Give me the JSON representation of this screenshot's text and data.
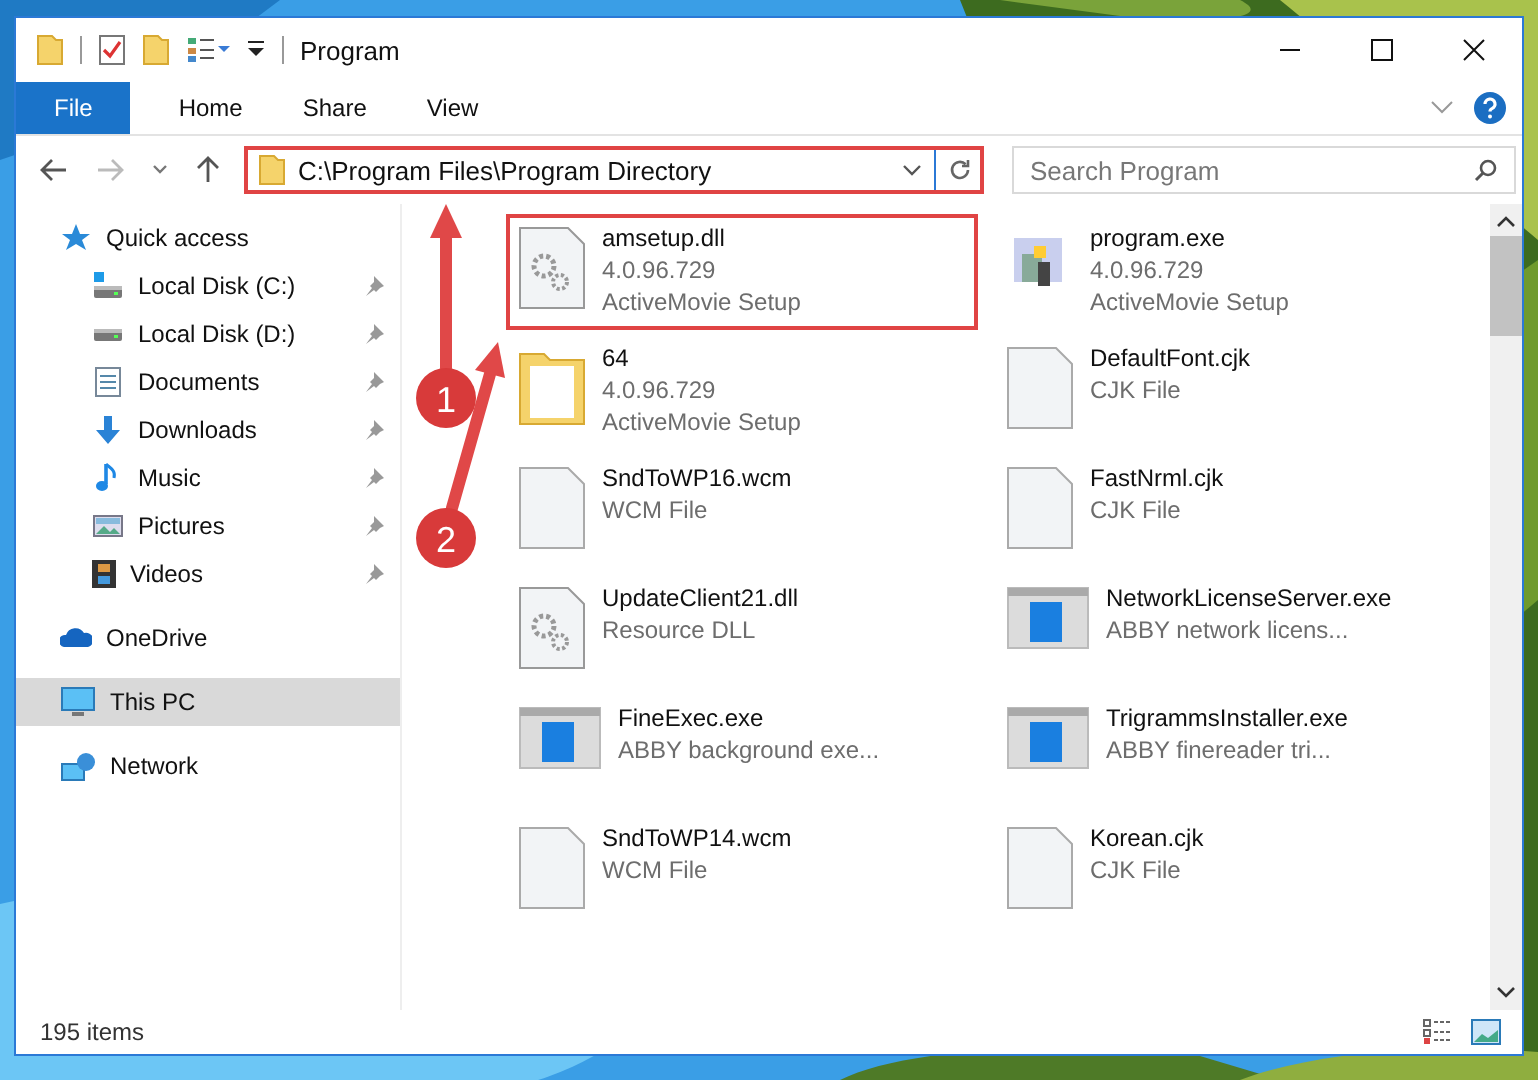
{
  "window": {
    "title": "Program"
  },
  "ribbon_tabs": [
    {
      "label": "File",
      "selected": true
    },
    {
      "label": "Home",
      "selected": false
    },
    {
      "label": "Share",
      "selected": false
    },
    {
      "label": "View",
      "selected": false
    }
  ],
  "address": {
    "path": "C:\\Program Files\\Program Directory",
    "highlighted": true
  },
  "search": {
    "placeholder": "Search Program"
  },
  "sidebar": {
    "items": [
      {
        "label": "Quick access",
        "kind": "quick",
        "pinned": false,
        "selected": false
      },
      {
        "label": "Local Disk (C:)",
        "kind": "drive-c",
        "pinned": true,
        "selected": false
      },
      {
        "label": "Local Disk (D:)",
        "kind": "drive",
        "pinned": true,
        "selected": false
      },
      {
        "label": "Documents",
        "kind": "documents",
        "pinned": true,
        "selected": false
      },
      {
        "label": "Downloads",
        "kind": "downloads",
        "pinned": true,
        "selected": false
      },
      {
        "label": "Music",
        "kind": "music",
        "pinned": true,
        "selected": false
      },
      {
        "label": "Pictures",
        "kind": "pictures",
        "pinned": true,
        "selected": false
      },
      {
        "label": "Videos",
        "kind": "videos",
        "pinned": true,
        "selected": false
      },
      {
        "label": "OneDrive",
        "kind": "cloud",
        "pinned": false,
        "selected": false
      },
      {
        "label": "This PC",
        "kind": "pc",
        "pinned": false,
        "selected": true
      },
      {
        "label": "Network",
        "kind": "network",
        "pinned": false,
        "selected": false
      }
    ]
  },
  "files": [
    {
      "name": "amsetup.dll",
      "lines": [
        "4.0.96.729",
        "ActiveMovie Setup"
      ],
      "kind": "dll",
      "highlighted": true
    },
    {
      "name": "program.exe",
      "lines": [
        "4.0.96.729",
        "ActiveMovie Setup"
      ],
      "kind": "setup",
      "highlighted": false
    },
    {
      "name": "64",
      "lines": [
        "4.0.96.729",
        "ActiveMovie Setup"
      ],
      "kind": "folder",
      "highlighted": false
    },
    {
      "name": "DefaultFont.cjk",
      "lines": [
        "CJK File"
      ],
      "kind": "document",
      "highlighted": false
    },
    {
      "name": "SndToWP16.wcm",
      "lines": [
        "WCM File"
      ],
      "kind": "document",
      "highlighted": false
    },
    {
      "name": "FastNrml.cjk",
      "lines": [
        "CJK File"
      ],
      "kind": "document",
      "highlighted": false
    },
    {
      "name": "UpdateClient21.dll",
      "lines": [
        "Resource DLL"
      ],
      "kind": "dll",
      "highlighted": false
    },
    {
      "name": "NetworkLicenseServer.exe",
      "lines": [
        "ABBY network licens..."
      ],
      "kind": "app",
      "highlighted": false
    },
    {
      "name": "FineExec.exe",
      "lines": [
        "ABBY background exe..."
      ],
      "kind": "app",
      "highlighted": false
    },
    {
      "name": "TrigrammsInstaller.exe",
      "lines": [
        "ABBY finereader tri..."
      ],
      "kind": "app",
      "highlighted": false
    },
    {
      "name": "SndToWP14.wcm",
      "lines": [
        "WCM File"
      ],
      "kind": "document",
      "highlighted": false
    },
    {
      "name": "Korean.cjk",
      "lines": [
        "CJK File"
      ],
      "kind": "document",
      "highlighted": false
    }
  ],
  "status_bar": {
    "count": "195 items"
  },
  "callouts": [
    {
      "number": "1"
    },
    {
      "number": "2"
    }
  ]
}
